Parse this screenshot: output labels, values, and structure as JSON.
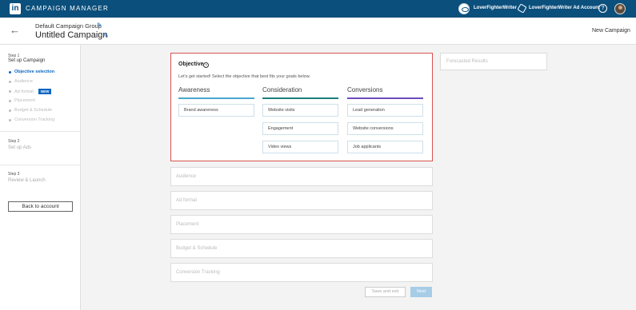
{
  "topbar": {
    "brand": "CAMPAIGN MANAGER",
    "logo_text": "in",
    "account_name": "LoverFighterWriter",
    "ad_account_name": "LoverFighterWriter Ad Account",
    "help_glyph": "?",
    "icons": [
      "linkedin-logo",
      "account-avatar-icon",
      "hexagon-icon",
      "help-icon",
      "user-avatar"
    ]
  },
  "header": {
    "back_glyph": "←",
    "group_name": "Default Campaign Group",
    "campaign_name": "Untitled Campaign",
    "edit_glyph": "✎",
    "new_campaign": "New Campaign"
  },
  "sidebar": {
    "step1": {
      "label": "Step 1",
      "title": "Set up Campaign",
      "items": [
        {
          "label": "Objective selection",
          "active": true
        },
        {
          "label": "Audience",
          "active": false
        },
        {
          "label": "Ad format",
          "active": false,
          "badge": "NEW"
        },
        {
          "label": "Placement",
          "active": false
        },
        {
          "label": "Budget & Schedule",
          "active": false
        },
        {
          "label": "Conversion Tracking",
          "active": false
        }
      ]
    },
    "step2": {
      "label": "Step 2",
      "title": "Set up Ads"
    },
    "step3": {
      "label": "Step 3",
      "title": "Review & Launch"
    },
    "back_button": "Back to account"
  },
  "objective": {
    "title": "Objective",
    "help_glyph": "?",
    "description": "Let's get started! Select the objective that best fits your goals below.",
    "columns": [
      {
        "heading": "Awareness",
        "color": "#49a7d0",
        "options": [
          "Brand awareness"
        ]
      },
      {
        "heading": "Consideration",
        "color": "#1c7f7a",
        "options": [
          "Website visits",
          "Engagement",
          "Video views"
        ]
      },
      {
        "heading": "Conversions",
        "color": "#6a4dbc",
        "options": [
          "Lead generation",
          "Website conversions",
          "Job applicants"
        ]
      }
    ]
  },
  "sections": [
    "Audience",
    "Ad format",
    "Placement",
    "Budget & Schedule",
    "Conversion Tracking"
  ],
  "forecast": {
    "title": "Forecasted Results"
  },
  "footer": {
    "save_label": "Save and exit",
    "next_label": "Next"
  },
  "colors": {
    "topbar": "#0b4f7c",
    "accent": "#0a66c2",
    "selected_border": "#d9534f"
  }
}
